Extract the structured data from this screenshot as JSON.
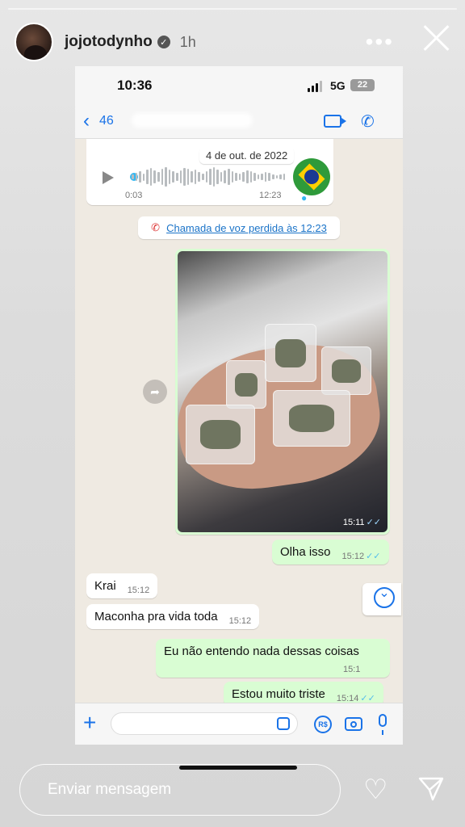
{
  "story": {
    "username": "jojotodynho",
    "time_ago": "1h",
    "more_icon": "more-horizontal-icon",
    "close_icon": "close-icon",
    "reply_placeholder": "Enviar mensagem"
  },
  "phone": {
    "status_time": "10:36",
    "network": "5G",
    "battery": "22",
    "back_count": "46"
  },
  "chat": {
    "audio": {
      "date": "4 de out. de 2022",
      "elapsed": "0:03",
      "time": "12:23"
    },
    "missed_call": "Chamada de voz perdida às 12:23",
    "photo_time": "15:11",
    "messages": [
      {
        "dir": "out",
        "text": "Olha isso",
        "time": "15:12"
      },
      {
        "dir": "in",
        "text": "Krai",
        "time": "15:12"
      },
      {
        "dir": "in",
        "text": "Maconha pra vida toda",
        "time": "15:12"
      },
      {
        "dir": "out",
        "text": "Eu não entendo nada dessas coisas",
        "time": "15:1"
      },
      {
        "dir": "out",
        "text": "Estou muito triste",
        "time": "15:14"
      }
    ]
  },
  "colors": {
    "outgoing_bubble": "#d9fdd3",
    "accent": "#1a73e8",
    "read_ticks": "#53bdeb"
  }
}
